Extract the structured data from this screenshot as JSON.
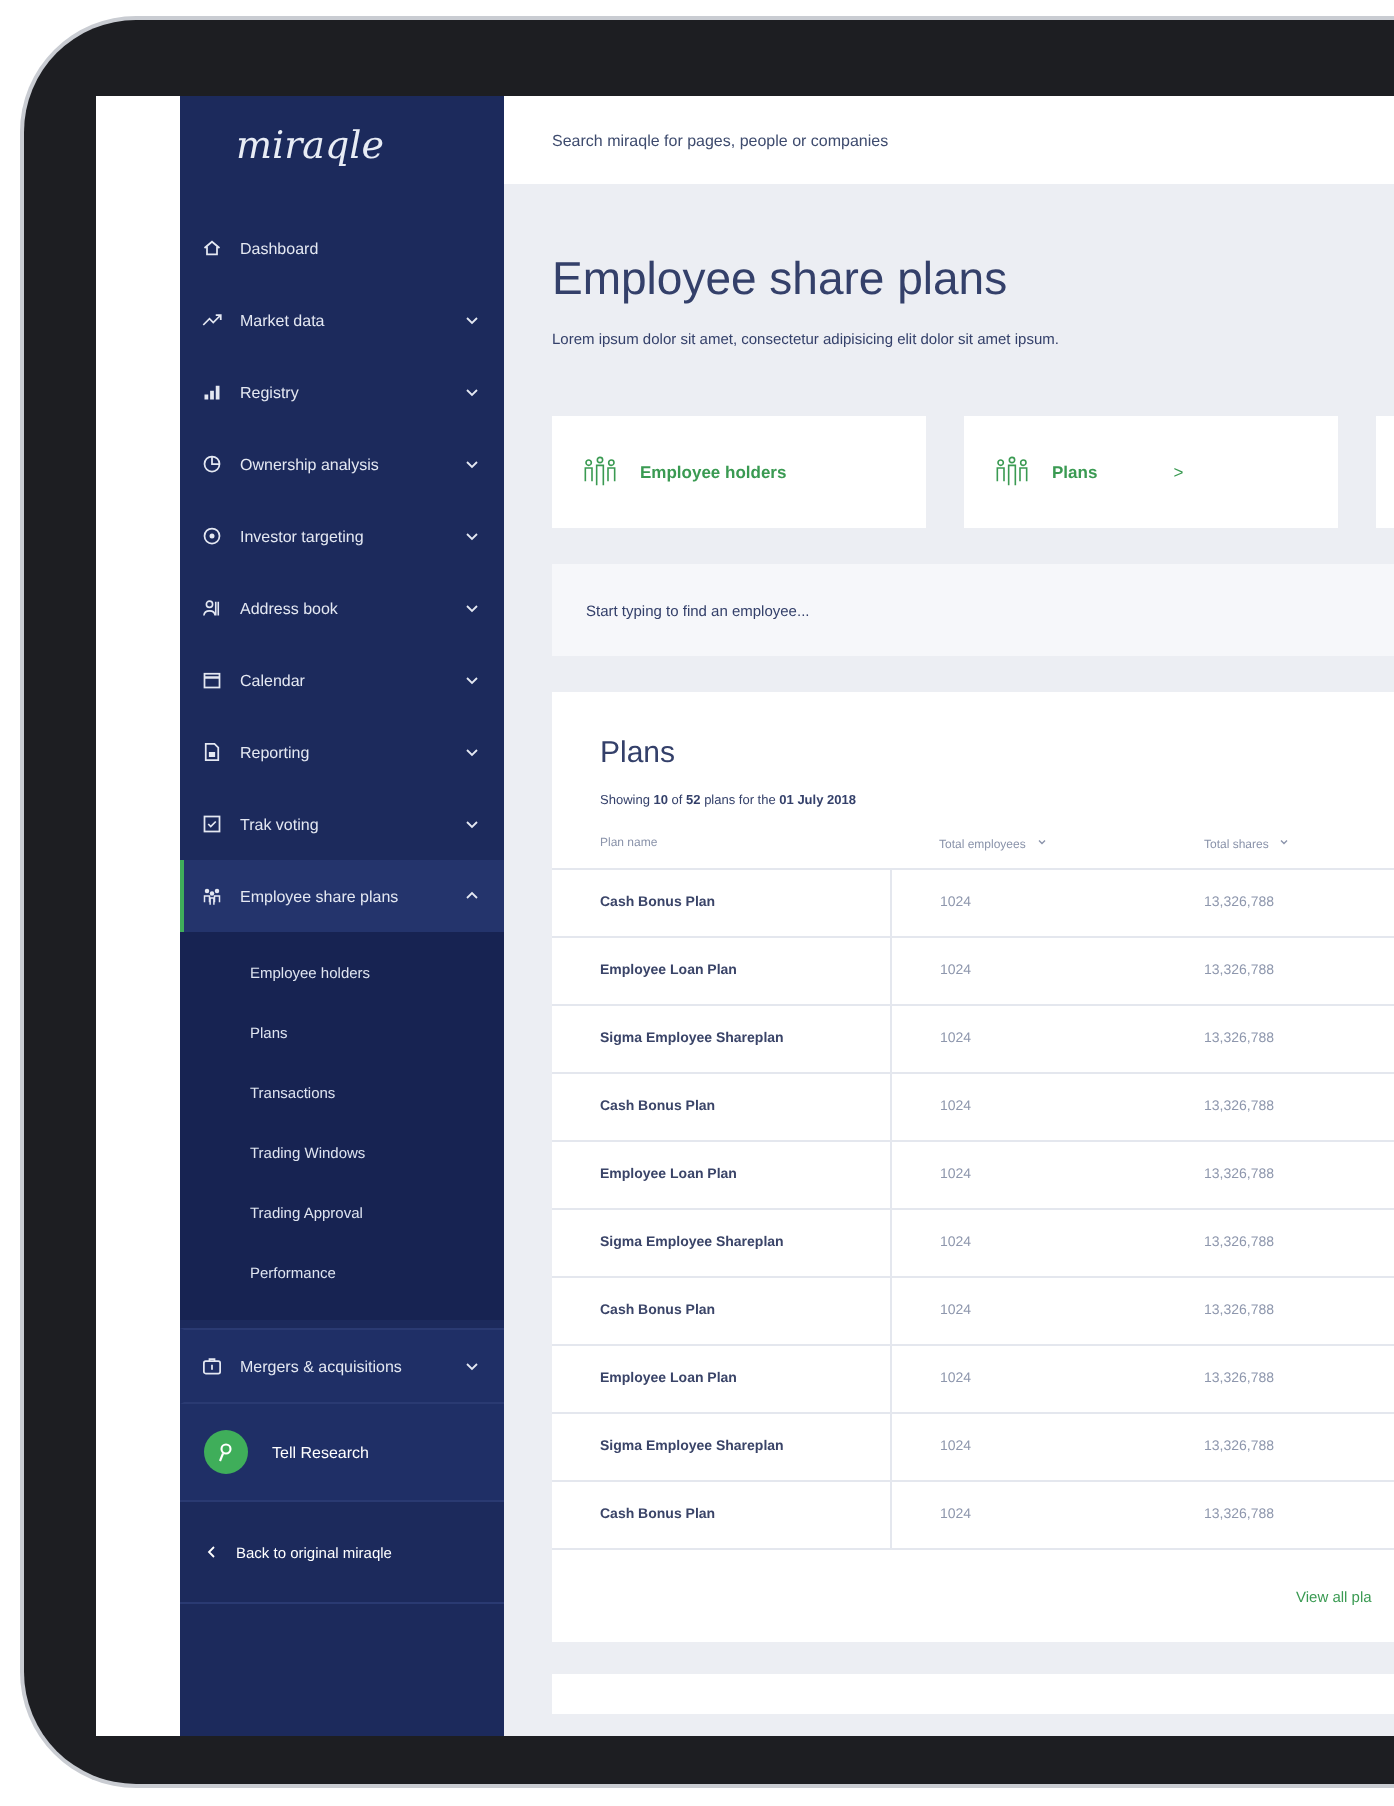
{
  "sidebar": {
    "logo": "miraqle",
    "items": [
      {
        "label": "Dashboard",
        "selected": false
      },
      {
        "label": "Market data",
        "selected": false,
        "expanded": false
      },
      {
        "label": "Registry",
        "selected": false,
        "expanded": false
      },
      {
        "label": "Ownership analysis",
        "selected": false,
        "expanded": false
      },
      {
        "label": "Investor targeting",
        "selected": false,
        "expanded": false
      },
      {
        "label": "Address book",
        "selected": false,
        "expanded": false
      },
      {
        "label": "Calendar",
        "selected": false,
        "expanded": false
      },
      {
        "label": "Reporting",
        "selected": false,
        "expanded": false
      },
      {
        "label": "Trak voting",
        "selected": false,
        "expanded": false
      },
      {
        "label": "Employee share plans",
        "selected": true,
        "expanded": true,
        "children": [
          {
            "label": "Employee holders"
          },
          {
            "label": "Plans"
          },
          {
            "label": "Transactions"
          },
          {
            "label": "Trading Windows"
          },
          {
            "label": "Trading Approval"
          },
          {
            "label": "Performance"
          }
        ]
      },
      {
        "label": "Mergers & acquisitions",
        "selected": false,
        "expanded": false
      }
    ],
    "tell_research": "Tell Research",
    "back_link": "Back to original miraqle"
  },
  "search": {
    "placeholder": "Search miraqle for pages, people or companies"
  },
  "page": {
    "title": "Employee share plans",
    "description": "Lorem ipsum dolor sit amet, consectetur adipisicing elit dolor sit amet ipsum."
  },
  "cards": [
    {
      "label": "Employee holders"
    },
    {
      "label": "Plans",
      "arrow": ">"
    }
  ],
  "employee_search": {
    "placeholder": "Start typing to find an employee..."
  },
  "plans": {
    "title": "Plans",
    "summary": "Showing **10** of **52** plans for the **01 July 2018**",
    "columns": [
      {
        "label": "Plan name",
        "sortable": false
      },
      {
        "label": "Total employees",
        "sortable": true
      },
      {
        "label": "Total shares",
        "sortable": true
      }
    ],
    "rows": [
      [
        "Cash Bonus Plan",
        "1024",
        "13,326,788"
      ],
      [
        "Employee Loan Plan",
        "1024",
        "13,326,788"
      ],
      [
        "Sigma Employee Shareplan",
        "1024",
        "13,326,788"
      ],
      [
        "Cash Bonus Plan",
        "1024",
        "13,326,788"
      ],
      [
        "Employee Loan Plan",
        "1024",
        "13,326,788"
      ],
      [
        "Sigma Employee Shareplan",
        "1024",
        "13,326,788"
      ],
      [
        "Cash Bonus Plan",
        "1024",
        "13,326,788"
      ],
      [
        "Employee Loan Plan",
        "1024",
        "13,326,788"
      ],
      [
        "Sigma Employee Shareplan",
        "1024",
        "13,326,788"
      ],
      [
        "Cash Bonus Plan",
        "1024",
        "13,326,788"
      ]
    ],
    "footer_link": "View all pla"
  }
}
